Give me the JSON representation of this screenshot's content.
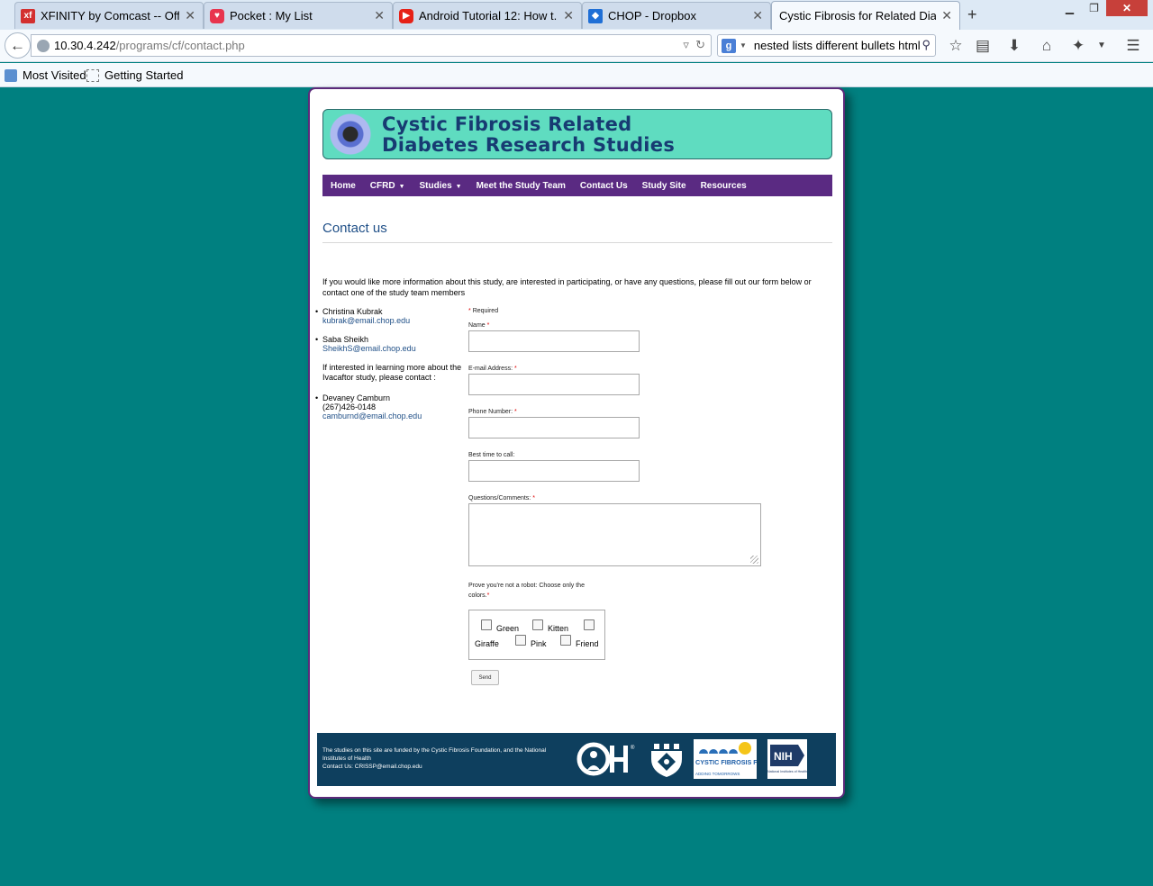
{
  "browser": {
    "tabs": [
      {
        "title": "XFINITY by Comcast -- Off...",
        "icon": "xfinity-icon",
        "color": "#d32f2f"
      },
      {
        "title": "Pocket : My List",
        "icon": "pocket-icon",
        "color": "#e8344e"
      },
      {
        "title": "Android Tutorial 12: How t...",
        "icon": "youtube-icon",
        "color": "#e62117"
      },
      {
        "title": "CHOP - Dropbox",
        "icon": "dropbox-icon",
        "color": "#1f6fd6"
      },
      {
        "title": "Cystic Fibrosis for Related Diab...",
        "icon": "none",
        "active": true
      }
    ],
    "url_host": "10.30.4.242",
    "url_path": "/programs/cf/contact.php",
    "search_value": "nested lists different bullets html",
    "bookmarks": [
      "Most Visited",
      "Getting Started"
    ]
  },
  "site": {
    "banner_line1": "Cystic Fibrosis Related",
    "banner_line2": "Diabetes Research Studies",
    "menu": [
      {
        "label": "Home",
        "dropdown": false
      },
      {
        "label": "CFRD",
        "dropdown": true
      },
      {
        "label": "Studies",
        "dropdown": true
      },
      {
        "label": "Meet the Study Team",
        "dropdown": false
      },
      {
        "label": "Contact Us",
        "dropdown": false
      },
      {
        "label": "Study Site",
        "dropdown": false
      },
      {
        "label": "Resources",
        "dropdown": false
      }
    ],
    "heading": "Contact us",
    "intro": "If you would like more information about this study, are interested in participating, or have any questions, please fill out our form below or contact one of the study team members"
  },
  "contacts": {
    "c1_name": "Christina Kubrak",
    "c1_email": "kubrak@email.chop.edu",
    "c2_name": "Saba Sheikh",
    "c2_email": "SheikhS@email.chop.edu",
    "note": "If interested in learning more about the Ivacaftor study, please contact :",
    "c3_name": "Devaney Camburn",
    "c3_phone": "(267)426-0148",
    "c3_email": "camburnd@email.chop.edu"
  },
  "form": {
    "required_note": "Required",
    "name_label": "Name",
    "email_label": "E-mail Address:",
    "phone_label": "Phone Number:",
    "besttime_label": "Best time to call:",
    "comments_label": "Questions/Comments:",
    "captcha_label": "Prove you're not a robot: Choose only the colors.",
    "captcha_options": [
      "Green",
      "Kitten",
      "Giraffe",
      "Pink",
      "Friend"
    ],
    "send_label": "Send"
  },
  "footer": {
    "text": "The studies on this site are funded by the Cystic Fibrosis Foundation, and the National Institutes of Health",
    "contact": "Contact Us: CRISSP@email.chop.edu",
    "logos": [
      "chop-logo",
      "penn-logo",
      "cystic-fibrosis-foundation-logo",
      "nih-logo"
    ],
    "cff_text": "CYSTIC FIBROSIS FOUNDATION",
    "cff_tag": "ADDING TOMORROWS",
    "nih_text": "NIH",
    "nih_sub": "National Institutes of Health"
  }
}
